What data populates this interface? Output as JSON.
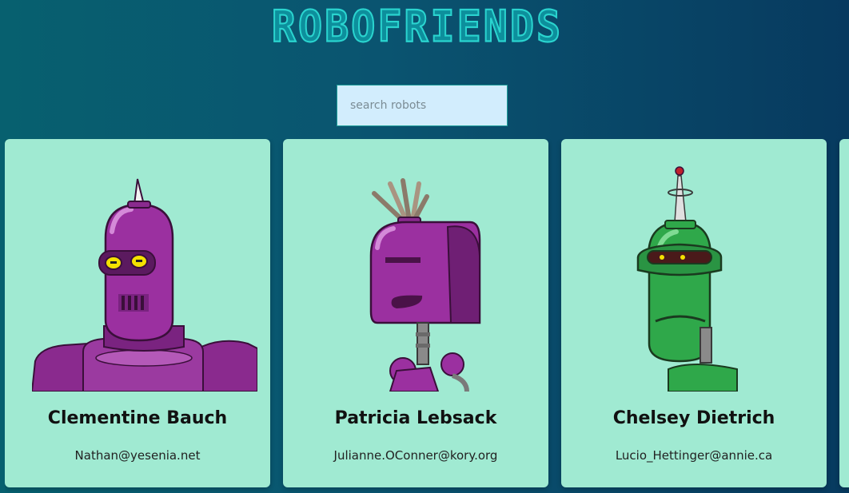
{
  "header": {
    "title": "ROBOFRIENDS"
  },
  "search": {
    "placeholder": "search robots",
    "value": ""
  },
  "robots": [
    {
      "name": "Clementine Bauch",
      "email": "Nathan@yesenia.net",
      "image_icon": "purple-horned-robot-icon"
    },
    {
      "name": "Patricia Lebsack",
      "email": "Julianne.OConner@kory.org",
      "image_icon": "purple-bucket-robot-icon"
    },
    {
      "name": "Chelsey Dietrich",
      "email": "Lucio_Hettinger@annie.ca",
      "image_icon": "green-antenna-robot-icon"
    }
  ],
  "colors": {
    "card_background": "#a0ead2",
    "title_color": "#2ad4cf",
    "search_background": "#d2edfd"
  }
}
